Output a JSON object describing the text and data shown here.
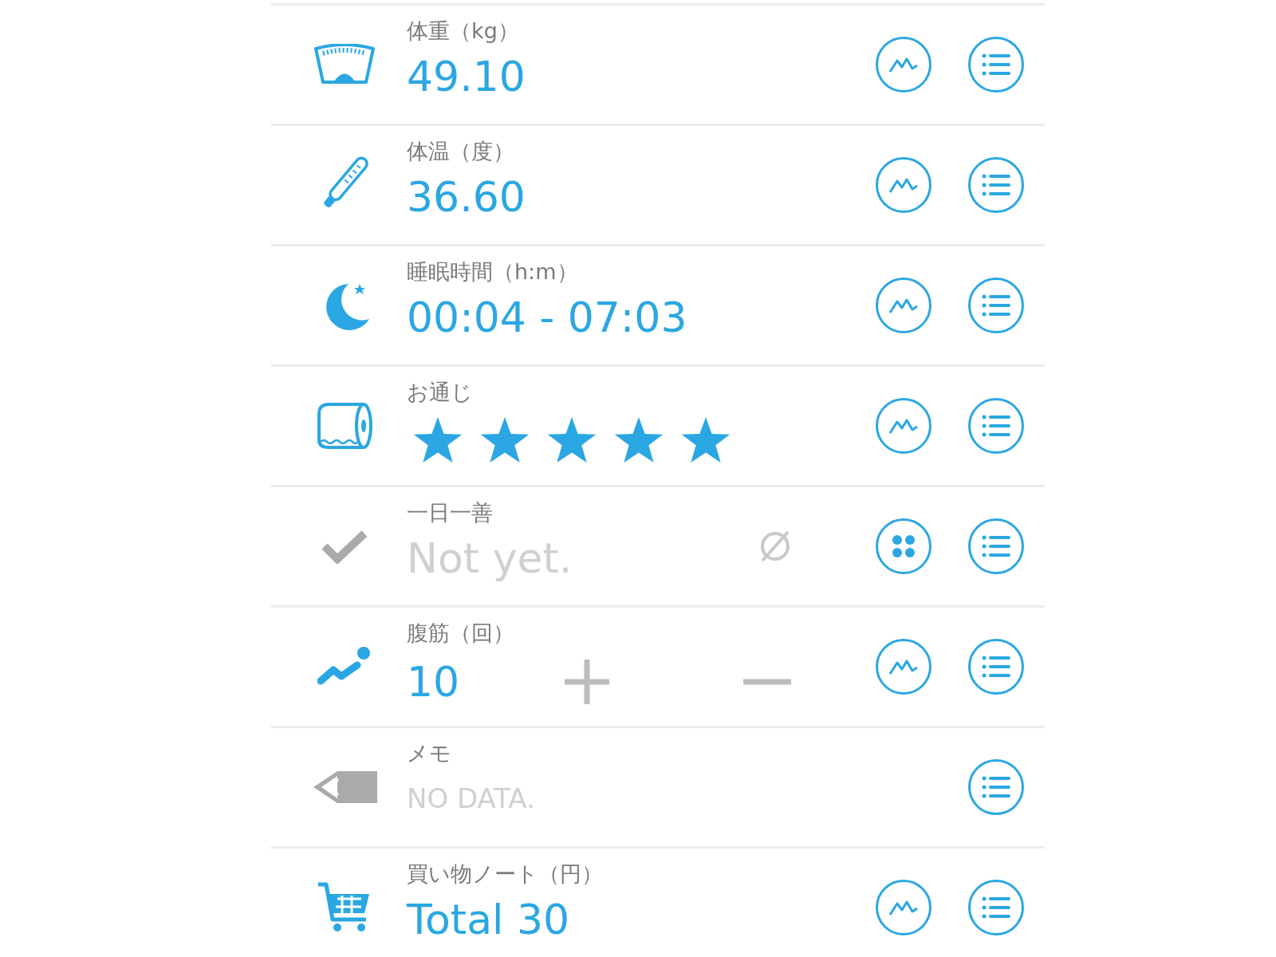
{
  "rows": [
    {
      "kind": "value",
      "label": "体重（kg）",
      "value": "49.10"
    },
    {
      "kind": "value",
      "label": "体温（度）",
      "value": "36.60"
    },
    {
      "kind": "value",
      "label": "睡眠時間（h:m）",
      "value": "00:04 - 07:03"
    },
    {
      "kind": "stars",
      "label": "お通じ",
      "stars": 5
    },
    {
      "kind": "check",
      "label": "一日一善",
      "value": "Not yet.",
      "done": false
    },
    {
      "kind": "counter",
      "label": "腹筋（回）",
      "value": "10"
    },
    {
      "kind": "memo",
      "label": "メモ",
      "value": "NO DATA."
    },
    {
      "kind": "value",
      "label": "買い物ノート（円）",
      "value": "Total 30"
    }
  ]
}
